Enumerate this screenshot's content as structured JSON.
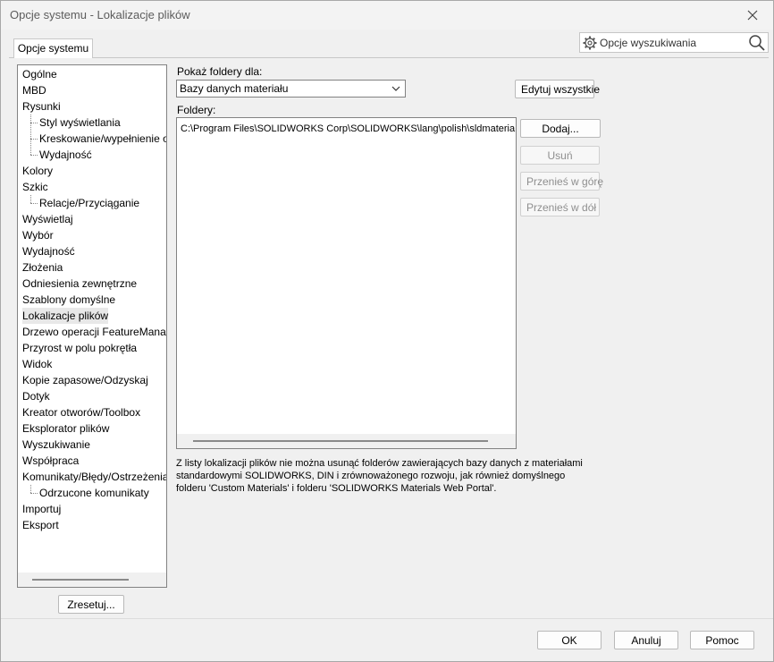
{
  "window": {
    "title": "Opcje systemu - Lokalizacje plików"
  },
  "tabs": [
    {
      "label": "Opcje systemu"
    }
  ],
  "search": {
    "placeholder": "Opcje wyszukiwania"
  },
  "tree": {
    "items": [
      {
        "label": "Ogólne",
        "level": 0
      },
      {
        "label": "MBD",
        "level": 0
      },
      {
        "label": "Rysunki",
        "level": 0
      },
      {
        "label": "Styl wyświetlania",
        "level": 1
      },
      {
        "label": "Kreskowanie/wypełnienie o",
        "level": 1
      },
      {
        "label": "Wydajność",
        "level": 1
      },
      {
        "label": "Kolory",
        "level": 0
      },
      {
        "label": "Szkic",
        "level": 0
      },
      {
        "label": "Relacje/Przyciąganie",
        "level": 1
      },
      {
        "label": "Wyświetlaj",
        "level": 0
      },
      {
        "label": "Wybór",
        "level": 0
      },
      {
        "label": "Wydajność",
        "level": 0
      },
      {
        "label": "Złożenia",
        "level": 0
      },
      {
        "label": "Odniesienia zewnętrzne",
        "level": 0
      },
      {
        "label": "Szablony domyślne",
        "level": 0
      },
      {
        "label": "Lokalizacje plików",
        "level": 0,
        "selected": true
      },
      {
        "label": "Drzewo operacji FeatureManag",
        "level": 0
      },
      {
        "label": "Przyrost w polu pokrętła",
        "level": 0
      },
      {
        "label": "Widok",
        "level": 0
      },
      {
        "label": "Kopie zapasowe/Odzyskaj",
        "level": 0
      },
      {
        "label": "Dotyk",
        "level": 0
      },
      {
        "label": "Kreator otworów/Toolbox",
        "level": 0
      },
      {
        "label": "Eksplorator plików",
        "level": 0
      },
      {
        "label": "Wyszukiwanie",
        "level": 0
      },
      {
        "label": "Współpraca",
        "level": 0
      },
      {
        "label": "Komunikaty/Błędy/Ostrzeżenia",
        "level": 0
      },
      {
        "label": "Odrzucone komunikaty",
        "level": 1
      },
      {
        "label": "Importuj",
        "level": 0
      },
      {
        "label": "Eksport",
        "level": 0
      }
    ]
  },
  "reset_button": "Zresetuj...",
  "show_folders": {
    "label": "Pokaż foldery dla:",
    "selected": "Bazy danych materiału"
  },
  "edit_all_button": "Edytuj wszystkie",
  "folders": {
    "label": "Foldery:",
    "rows": [
      "C:\\Program Files\\SOLIDWORKS Corp\\SOLIDWORKS\\lang\\polish\\sldmateria"
    ]
  },
  "side_buttons": {
    "add": "Dodaj...",
    "remove": "Usuń",
    "move_up": "Przenieś w górę",
    "move_down": "Przenieś w dół"
  },
  "info": "Z listy lokalizacji plików nie można usunąć folderów zawierających bazy danych z materiałami standardowymi SOLIDWORKS, DIN i zrównoważonego rozwoju, jak również domyślnego folderu 'Custom Materials' i folderu 'SOLIDWORKS Materials Web Portal'.",
  "footer": {
    "ok": "OK",
    "cancel": "Anuluj",
    "help": "Pomoc"
  }
}
